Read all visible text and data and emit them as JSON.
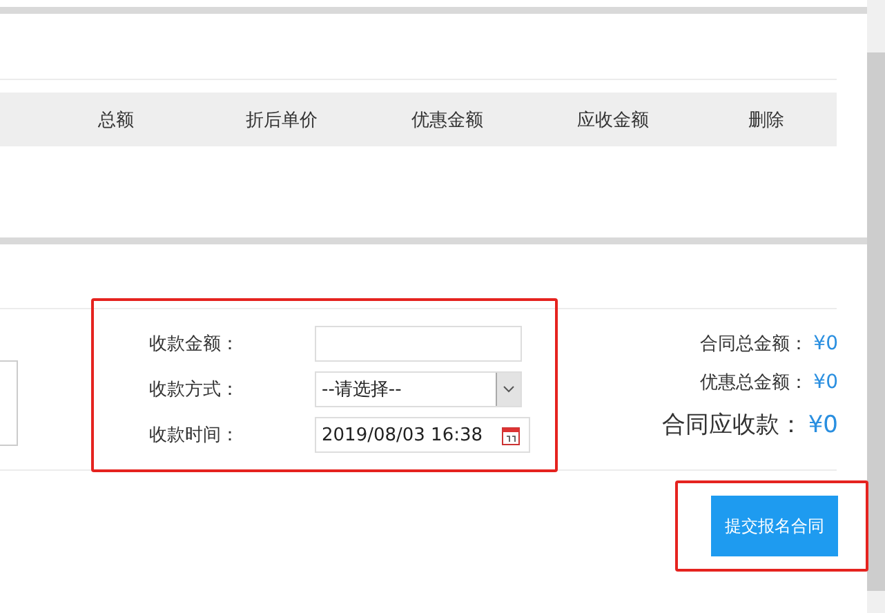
{
  "table": {
    "columns": [
      "总额",
      "折后单价",
      "优惠金额",
      "应收金额",
      "删除"
    ]
  },
  "payment_form": {
    "fields": [
      {
        "kind": "input",
        "label": "收款金额："
      },
      {
        "kind": "select",
        "label": "收款方式：",
        "value": "--请选择--"
      },
      {
        "kind": "date",
        "label": "收款时间：",
        "value": "2019/08/03 16:38"
      }
    ]
  },
  "summary": [
    {
      "kind": "line",
      "label": "合同总金额：",
      "value": "¥0"
    },
    {
      "kind": "line",
      "label": "优惠总金额：",
      "value": "¥0"
    },
    {
      "kind": "total",
      "label": "合同应收款：",
      "value": "¥0"
    }
  ],
  "submit_button": "提交报名合同"
}
